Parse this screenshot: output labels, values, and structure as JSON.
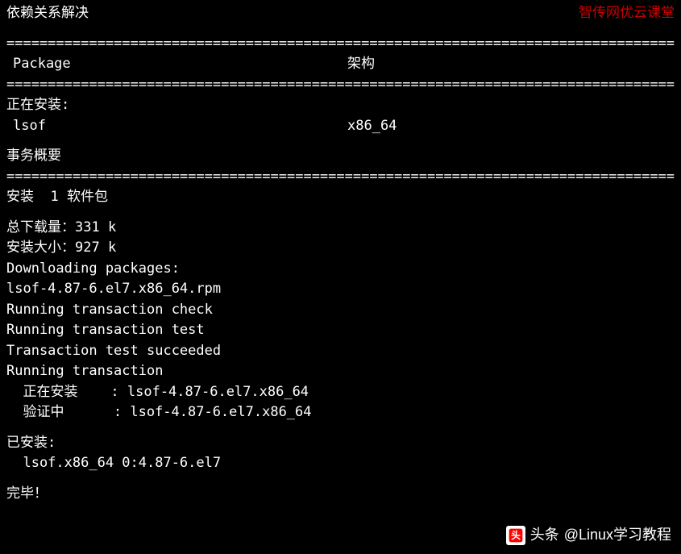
{
  "header": {
    "title": "依赖关系解决",
    "watermark": "智传网优云课堂"
  },
  "table": {
    "header_package": "Package",
    "header_arch": "架构",
    "installing_label": "正在安装:",
    "package_name": "lsof",
    "package_arch": "x86_64"
  },
  "summary": {
    "title": "事务概要",
    "install_count": "安装  1 软件包"
  },
  "download": {
    "total_download": "总下载量：331 k",
    "install_size": "安装大小：927 k",
    "downloading": "Downloading packages:",
    "rpm_file": "lsof-4.87-6.el7.x86_64.rpm",
    "trans_check": "Running transaction check",
    "trans_test": "Running transaction test",
    "trans_succeeded": "Transaction test succeeded",
    "trans_running": "Running transaction",
    "installing_line": "  正在安装    : lsof-4.87-6.el7.x86_64",
    "verifying_line": "  验证中      : lsof-4.87-6.el7.x86_64"
  },
  "installed": {
    "label": "已安装:",
    "package": "  lsof.x86_64 0:4.87-6.el7"
  },
  "complete": "完毕！",
  "divider": "================================================================================================",
  "watermark_bottom": {
    "prefix": "头条",
    "handle": "@Linux学习教程"
  }
}
